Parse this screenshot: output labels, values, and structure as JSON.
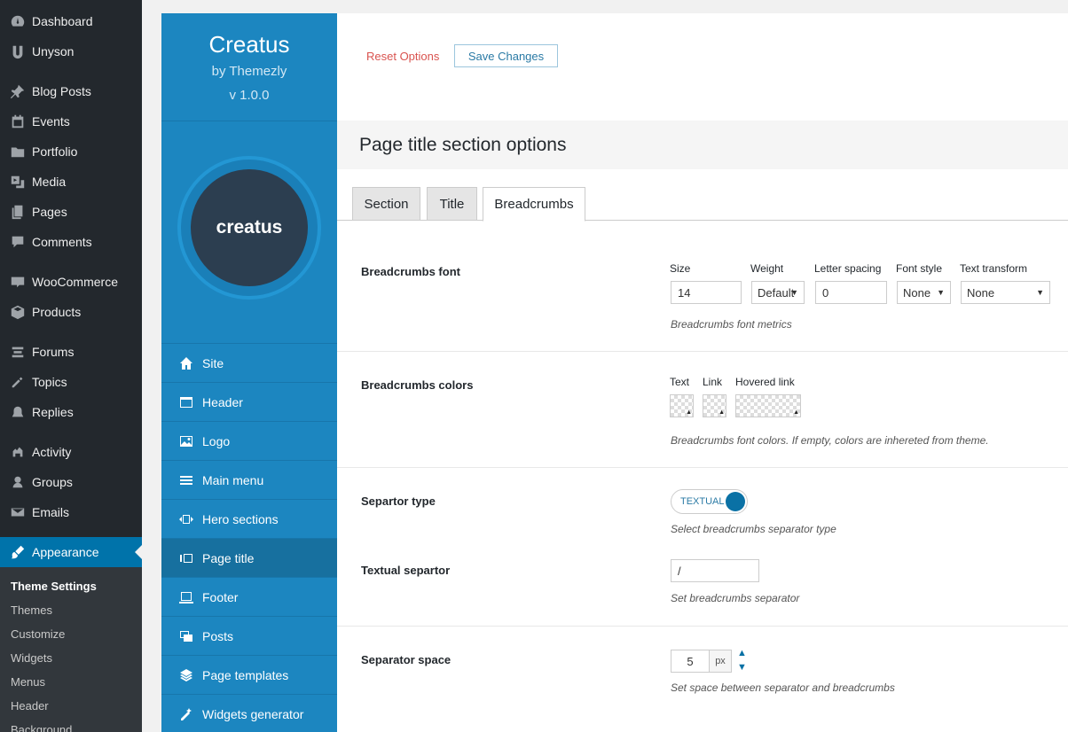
{
  "wp_menu": {
    "items": [
      {
        "label": "Dashboard",
        "icon": "dashboard-icon"
      },
      {
        "label": "Unyson",
        "icon": "unyson-icon"
      },
      {
        "label": "Blog Posts",
        "icon": "pin-icon"
      },
      {
        "label": "Events",
        "icon": "calendar-icon"
      },
      {
        "label": "Portfolio",
        "icon": "folder-icon"
      },
      {
        "label": "Media",
        "icon": "media-icon"
      },
      {
        "label": "Pages",
        "icon": "pages-icon"
      },
      {
        "label": "Comments",
        "icon": "comment-icon"
      },
      {
        "label": "WooCommerce",
        "icon": "woo-icon"
      },
      {
        "label": "Products",
        "icon": "box-icon"
      },
      {
        "label": "Forums",
        "icon": "forums-icon"
      },
      {
        "label": "Topics",
        "icon": "topics-icon"
      },
      {
        "label": "Replies",
        "icon": "replies-icon"
      },
      {
        "label": "Activity",
        "icon": "activity-icon"
      },
      {
        "label": "Groups",
        "icon": "groups-icon"
      },
      {
        "label": "Emails",
        "icon": "email-icon"
      },
      {
        "label": "Appearance",
        "icon": "brush-icon"
      }
    ],
    "submenu": [
      "Theme Settings",
      "Themes",
      "Customize",
      "Widgets",
      "Menus",
      "Header",
      "Background"
    ]
  },
  "panel": {
    "name": "Creatus",
    "by": "by Themezly",
    "version": "v 1.0.0",
    "logo_text": "creatus",
    "nav": [
      {
        "label": "Site",
        "icon": "home-icon"
      },
      {
        "label": "Header",
        "icon": "window-icon"
      },
      {
        "label": "Logo",
        "icon": "image-icon"
      },
      {
        "label": "Main menu",
        "icon": "menu-icon"
      },
      {
        "label": "Hero sections",
        "icon": "hero-icon"
      },
      {
        "label": "Page title",
        "icon": "page-title-icon"
      },
      {
        "label": "Footer",
        "icon": "footer-icon"
      },
      {
        "label": "Posts",
        "icon": "posts-icon"
      },
      {
        "label": "Page templates",
        "icon": "layers-icon"
      },
      {
        "label": "Widgets generator",
        "icon": "wand-icon"
      }
    ]
  },
  "toolbar": {
    "reset_label": "Reset Options",
    "save_label": "Save Changes"
  },
  "section": {
    "title": "Page title section options"
  },
  "tabs": [
    "Section",
    "Title",
    "Breadcrumbs"
  ],
  "font_row": {
    "label": "Breadcrumbs font",
    "size_label": "Size",
    "size_value": "14",
    "weight_label": "Weight",
    "weight_value": "Default",
    "spacing_label": "Letter spacing",
    "spacing_value": "0",
    "style_label": "Font style",
    "style_value": "None",
    "transform_label": "Text transform",
    "transform_value": "None",
    "hint": "Breadcrumbs font metrics"
  },
  "colors_row": {
    "label": "Breadcrumbs colors",
    "text_label": "Text",
    "link_label": "Link",
    "hovered_label": "Hovered link",
    "hint": "Breadcrumbs font colors. If empty, colors are inhereted from theme."
  },
  "separator_type": {
    "label": "Separtor type",
    "toggle_text": "TEXTUAL",
    "hint": "Select breadcrumbs separator type"
  },
  "textual_separator": {
    "label": "Textual separtor",
    "value": "/",
    "hint": "Set breadcrumbs separator"
  },
  "separator_space": {
    "label": "Separator space",
    "value": "5",
    "unit": "px",
    "hint": "Set space between separator and breadcrumbs"
  }
}
